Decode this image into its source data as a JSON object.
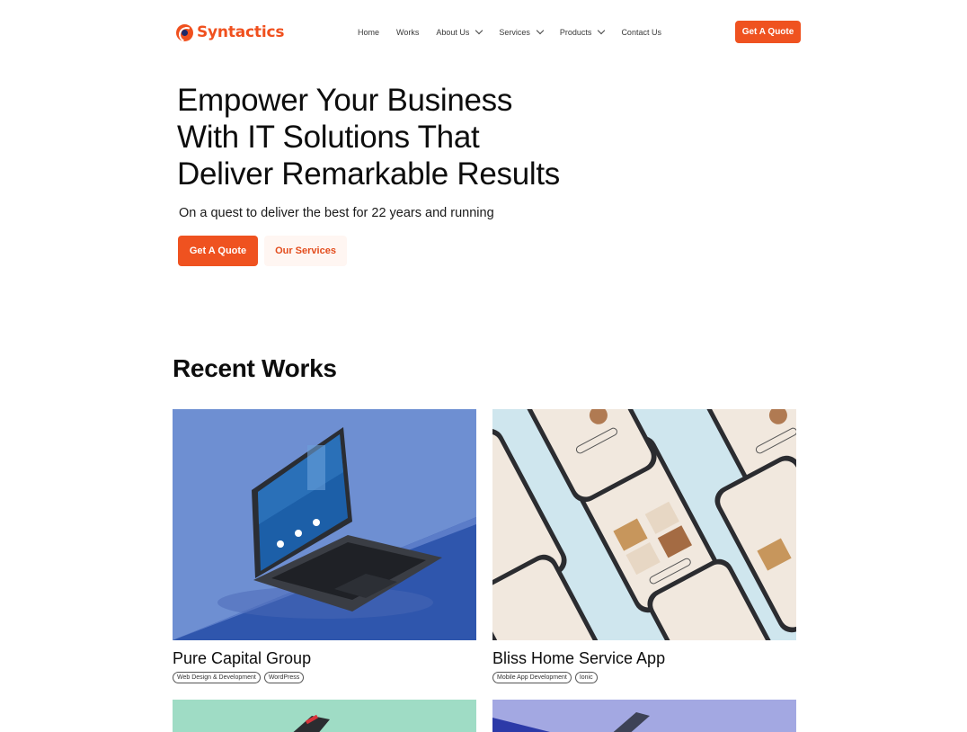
{
  "brand": {
    "name": "Syntactics",
    "accent": "#ef5220"
  },
  "nav": {
    "items": [
      {
        "label": "Home",
        "dropdown": false
      },
      {
        "label": "Works",
        "dropdown": false
      },
      {
        "label": "About Us",
        "dropdown": true
      },
      {
        "label": "Services",
        "dropdown": true
      },
      {
        "label": "Products",
        "dropdown": true
      },
      {
        "label": "Contact Us",
        "dropdown": false
      }
    ],
    "cta": "Get A Quote"
  },
  "hero": {
    "title_line1": "Empower Your Business",
    "title_line2": "With IT Solutions That",
    "title_line3": "Deliver Remarkable Results",
    "subtitle": "On a quest to deliver the best for 22 years and running",
    "primary_button": "Get A Quote",
    "secondary_button": "Our Services"
  },
  "works": {
    "title": "Recent Works",
    "items": [
      {
        "title": "Pure Capital Group",
        "tags": [
          "Web Design & Development",
          "WordPress"
        ],
        "image": "laptop-mockup"
      },
      {
        "title": "Bliss Home Service App",
        "tags": [
          "Mobile App Development",
          "Ionic"
        ],
        "image": "phones-mockup"
      }
    ]
  }
}
